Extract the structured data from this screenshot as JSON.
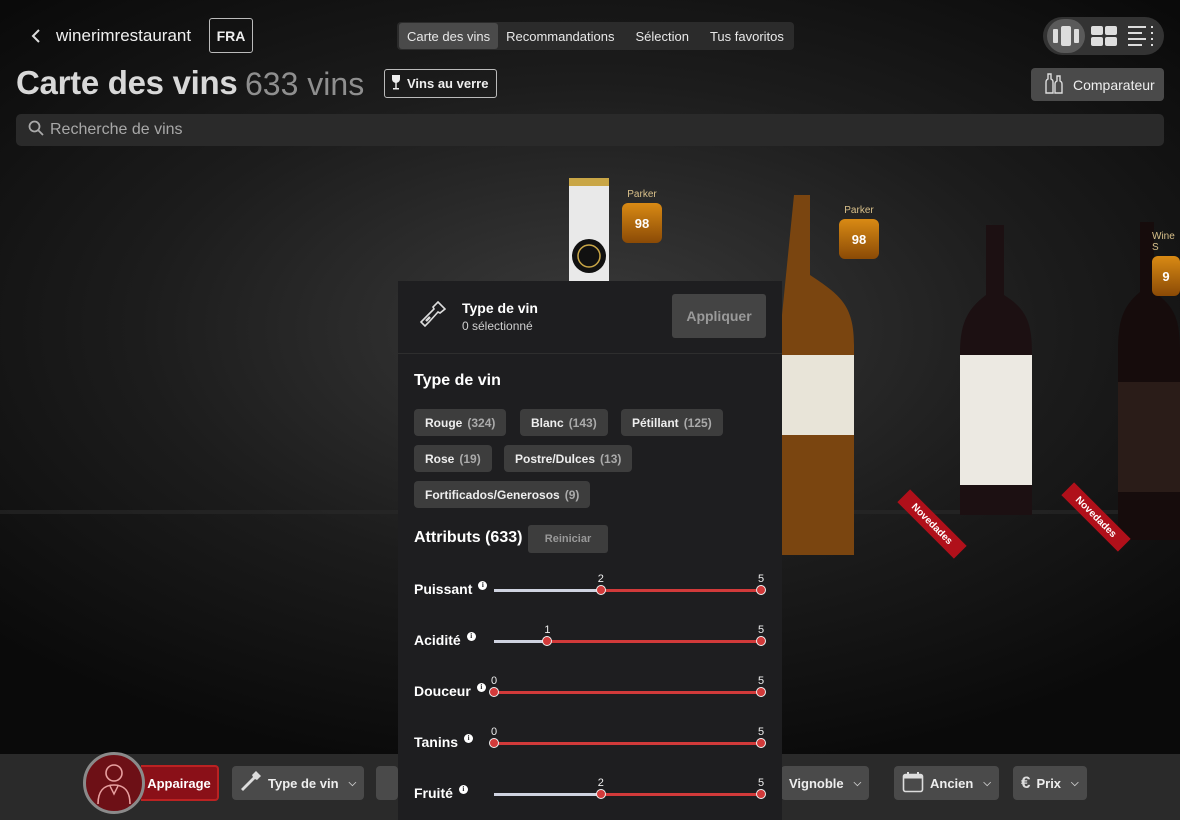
{
  "header": {
    "brand": "winerimrestaurant",
    "language": "FRA",
    "tabs": [
      "Carte des vins",
      "Recommandations",
      "Sélection",
      "Tus favoritos"
    ],
    "active_tab": "Carte des vins"
  },
  "page": {
    "title": "Carte des vins",
    "count": "633 vins",
    "glass_button": "Vins au verre",
    "compare_button": "Comparateur"
  },
  "search": {
    "placeholder": "Recherche de vins"
  },
  "bottles": {
    "badge1": {
      "source": "Parker",
      "score": "98"
    },
    "badge2": {
      "source": "Parker",
      "score": "98"
    },
    "badge3": {
      "source": "Wine S",
      "score": "9"
    },
    "ribbon1": "Novedades",
    "ribbon2": "Novedades"
  },
  "panel": {
    "title": "Type de vin",
    "subtitle": "0 sélectionné",
    "apply": "Appliquer",
    "section_title": "Type de vin",
    "chips": [
      {
        "label": "Rouge",
        "count": "(324)"
      },
      {
        "label": "Blanc",
        "count": "(143)"
      },
      {
        "label": "Pétillant",
        "count": "(125)"
      },
      {
        "label": "Rose",
        "count": "(19)"
      },
      {
        "label": "Postre/Dulces",
        "count": "(13)"
      },
      {
        "label": "Fortificados/Generosos",
        "count": "(9)"
      }
    ],
    "attributes_title": "Attributs (633)",
    "reset": "Reiniciar",
    "attributes": [
      {
        "label": "Puissant",
        "min": 2,
        "max": 5,
        "min_label": "2",
        "max_label": "5"
      },
      {
        "label": "Acidité",
        "min": 1,
        "max": 5,
        "min_label": "1",
        "max_label": "5"
      },
      {
        "label": "Douceur",
        "min": 0,
        "max": 5,
        "min_label": "0",
        "max_label": "5"
      },
      {
        "label": "Tanins",
        "min": 0,
        "max": 5,
        "min_label": "0",
        "max_label": "5"
      },
      {
        "label": "Fruité",
        "min": 2,
        "max": 5,
        "min_label": "2",
        "max_label": "5"
      }
    ],
    "scale_max": 5
  },
  "bottom": {
    "pairing": "Appairage",
    "type": "Type de vin",
    "vineyard": "Vignoble",
    "vintage": "Ancien",
    "price": "Prix"
  },
  "colors": {
    "accent": "#d23a3a",
    "pairing": "#8a1018",
    "badge": "#d98a14"
  }
}
